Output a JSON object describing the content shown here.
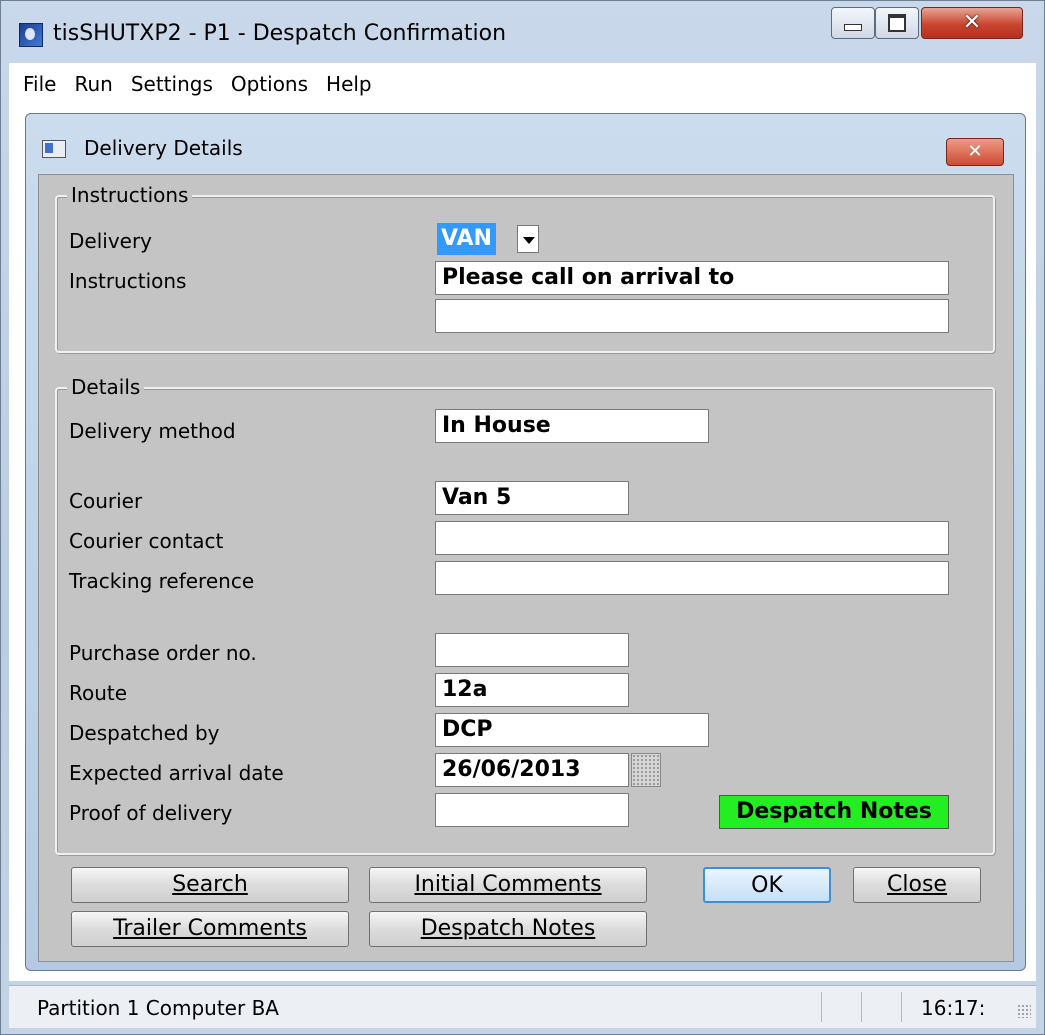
{
  "window": {
    "title": "tisSHUTXP2 - P1 - Despatch Confirmation"
  },
  "menu": [
    "File",
    "Run",
    "Settings",
    "Options",
    "Help"
  ],
  "dialog": {
    "title": "Delivery Details"
  },
  "instructions_group": {
    "label": "Instructions",
    "delivery_label": "Delivery",
    "delivery_value": "VAN",
    "instructions_label": "Instructions",
    "instructions_line1": "Please call on arrival to",
    "instructions_line2": ""
  },
  "details_group": {
    "label": "Details",
    "delivery_method_label": "Delivery method",
    "delivery_method_value": "In House",
    "courier_label": "Courier",
    "courier_value": "Van 5",
    "courier_contact_label": "Courier contact",
    "courier_contact_value": "",
    "tracking_reference_label": "Tracking reference",
    "tracking_reference_value": "",
    "purchase_order_label": "Purchase order no.",
    "purchase_order_value": "",
    "route_label": "Route",
    "route_value": "12a",
    "despatched_by_label": "Despatched by",
    "despatched_by_value": "DCP",
    "expected_arrival_label": "Expected arrival date",
    "expected_arrival_value": "26/06/2013",
    "proof_of_delivery_label": "Proof of delivery",
    "proof_of_delivery_value": "",
    "despatch_notes_indicator": "Despatch Notes"
  },
  "buttons": {
    "search": "Search",
    "initial_comments": "Initial Comments",
    "ok": "OK",
    "close": "Close",
    "trailer_comments": "Trailer Comments",
    "despatch_notes": "Despatch Notes"
  },
  "status": {
    "text": "Partition 1 Computer BA",
    "time": "16:17:"
  },
  "colors": {
    "selection": "#3399ff",
    "despatch_notes_indicator": "#22ee22",
    "dialog_face": "#c4c4c4"
  }
}
